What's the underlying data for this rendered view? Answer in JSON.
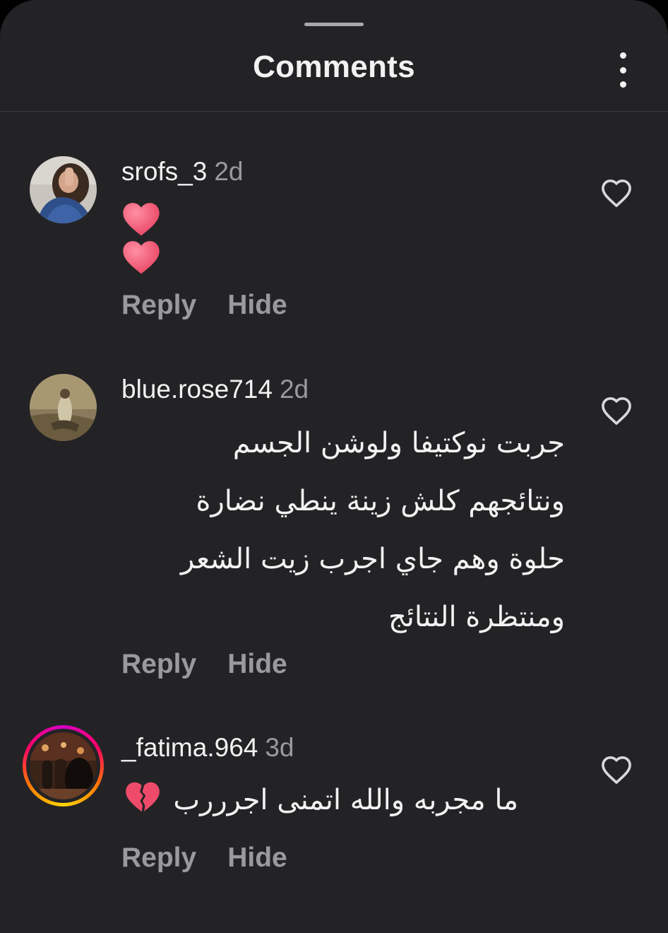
{
  "header": {
    "title": "Comments",
    "menu_icon": "more-vertical-icon"
  },
  "comments": [
    {
      "username": "srofs_3",
      "time": "2d",
      "text": "",
      "emojis": [
        "red-heart-emoji",
        "red-heart-emoji"
      ],
      "reply_label": "Reply",
      "hide_label": "Hide",
      "like_icon": "heart-outline-icon"
    },
    {
      "username": "blue.rose714",
      "time": "2d",
      "text": "جربت نوكتيفا ولوشن الجسم ونتائجهم كلش زينة ينطي نضارة حلوة وهم جاي اجرب زيت الشعر ومنتظرة النتائج",
      "lines": [
        "جربت نوكتيفا ولوشن الجسم",
        "ونتائجهم كلش زينة ينطي نضارة",
        "حلوة وهم جاي اجرب زيت الشعر",
        "ومنتظرة النتائج"
      ],
      "reply_label": "Reply",
      "hide_label": "Hide",
      "like_icon": "heart-outline-icon"
    },
    {
      "username": "_fatima.964",
      "time": "3d",
      "text": "ما مجربه والله اتمنى اجرررب",
      "emojis": [
        "broken-heart-emoji"
      ],
      "has_story_ring": true,
      "reply_label": "Reply",
      "hide_label": "Hide",
      "like_icon": "heart-outline-icon"
    }
  ],
  "colors": {
    "background": "#232326",
    "text_primary": "#f2f2f2",
    "text_secondary": "#9a9a9e",
    "heart_emoji": "#f25c7a"
  }
}
